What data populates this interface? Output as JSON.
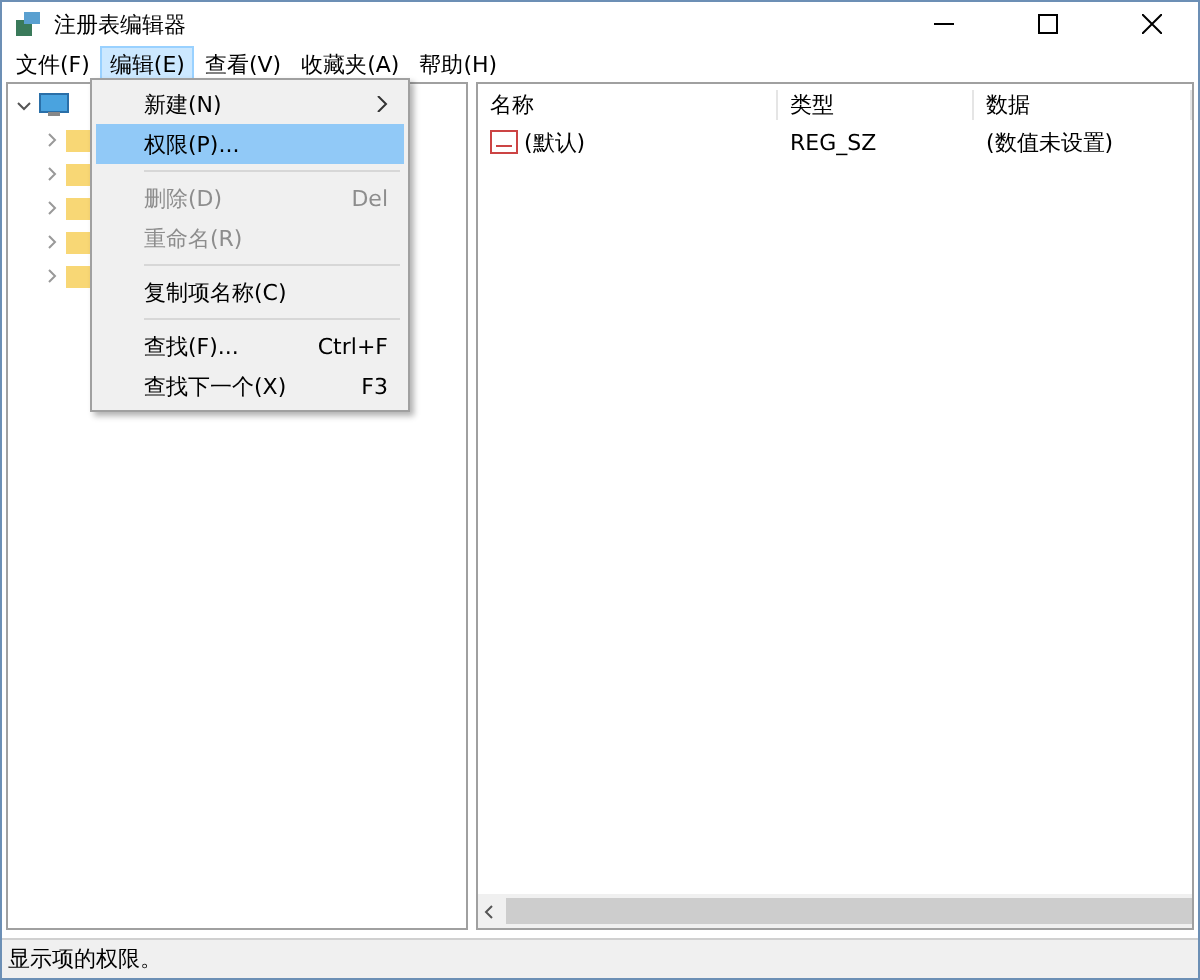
{
  "window": {
    "title": "注册表编辑器"
  },
  "menu_bar": [
    {
      "label": "文件(F)",
      "selected": false
    },
    {
      "label": "编辑(E)",
      "selected": true
    },
    {
      "label": "查看(V)",
      "selected": false
    },
    {
      "label": "收藏夹(A)",
      "selected": false
    },
    {
      "label": "帮助(H)",
      "selected": false
    }
  ],
  "tree": {
    "expanded": true,
    "children": [
      {
        "expanded": false
      },
      {
        "expanded": false
      },
      {
        "expanded": false
      },
      {
        "expanded": false
      },
      {
        "expanded": false
      }
    ]
  },
  "edit_menu": [
    {
      "kind": "item",
      "label": "新建(N)",
      "submenu": true,
      "disabled": false,
      "selected": false
    },
    {
      "kind": "item",
      "label": "权限(P)...",
      "submenu": false,
      "disabled": false,
      "selected": true
    },
    {
      "kind": "separator"
    },
    {
      "kind": "item",
      "label": "删除(D)",
      "shortcut": "Del",
      "submenu": false,
      "disabled": true,
      "selected": false
    },
    {
      "kind": "item",
      "label": "重命名(R)",
      "submenu": false,
      "disabled": true,
      "selected": false
    },
    {
      "kind": "separator"
    },
    {
      "kind": "item",
      "label": "复制项名称(C)",
      "submenu": false,
      "disabled": false,
      "selected": false
    },
    {
      "kind": "separator"
    },
    {
      "kind": "item",
      "label": "查找(F)...",
      "shortcut": "Ctrl+F",
      "submenu": false,
      "disabled": false,
      "selected": false
    },
    {
      "kind": "item",
      "label": "查找下一个(X)",
      "shortcut": "F3",
      "submenu": false,
      "disabled": false,
      "selected": false
    }
  ],
  "table": {
    "columns": [
      "名称",
      "类型",
      "数据"
    ],
    "rows": [
      {
        "name": "(默认)",
        "type": "REG_SZ",
        "data": "(数值未设置)"
      }
    ]
  },
  "status_bar": "显示项的权限。"
}
